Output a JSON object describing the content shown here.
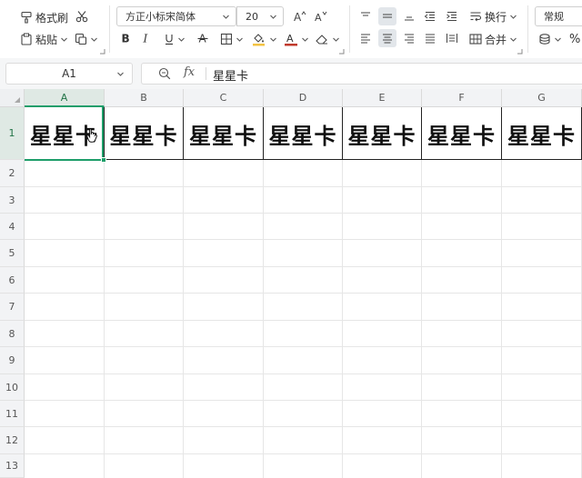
{
  "ribbon": {
    "format_painter": "格式刷",
    "paste": "粘贴",
    "font_name": "方正小标宋简体",
    "font_size": "20",
    "wrap_text": "换行",
    "merge": "合并",
    "number_format": "常规",
    "percent": "%"
  },
  "formula_bar": {
    "name_box": "A1",
    "fx": "fx",
    "content": "星星卡"
  },
  "grid": {
    "columns": [
      "A",
      "B",
      "C",
      "D",
      "E",
      "F",
      "G"
    ],
    "rows": [
      "1",
      "2",
      "3",
      "4",
      "5",
      "6",
      "7",
      "8",
      "9",
      "10",
      "11",
      "12",
      "13"
    ],
    "row1_values": [
      "星星卡",
      "星星卡",
      "星星卡",
      "星星卡",
      "星星卡",
      "星星卡",
      "星星卡"
    ],
    "selected_cell": "A1"
  },
  "colors": {
    "accent": "#1e9e6a",
    "font_color_bar": "#c0392b",
    "fill_color_bar": "#f3c343"
  }
}
